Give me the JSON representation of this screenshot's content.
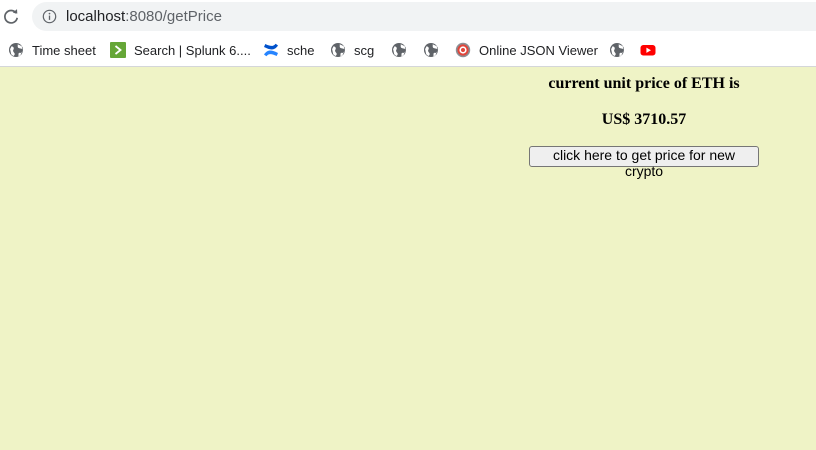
{
  "browser": {
    "address": {
      "host": "localhost",
      "path": ":8080/getPrice"
    },
    "bookmarks": [
      {
        "label": "Time sheet",
        "icon": "globe-icon"
      },
      {
        "label": "Search | Splunk 6....",
        "icon": "splunk-icon"
      },
      {
        "label": "sche",
        "icon": "confluence-icon"
      },
      {
        "label": "scg",
        "icon": "globe-icon"
      },
      {
        "label": "",
        "icon": "globe-icon"
      },
      {
        "label": "",
        "icon": "globe-icon"
      },
      {
        "label": "Online JSON Viewer",
        "icon": "json-viewer-icon"
      },
      {
        "label": "",
        "icon": "globe-icon"
      },
      {
        "label": "",
        "icon": "youtube-icon"
      }
    ]
  },
  "page": {
    "heading": "current unit price of ETH is",
    "price": "US$ 3710.57",
    "button_label": "click here to get price for new crypto"
  },
  "colors": {
    "page_background": "#eff3c6",
    "splunk_green": "#65a637",
    "confluence_blue": "#2684ff",
    "youtube_red": "#ff0000"
  }
}
